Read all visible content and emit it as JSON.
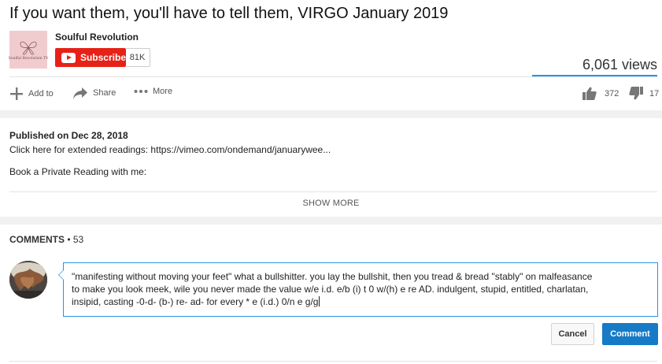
{
  "video": {
    "title": "If you want them, you'll have to tell them, VIRGO January 2019",
    "views": "6,061 views"
  },
  "channel": {
    "name": "Soulful Revolution",
    "thumb_text": "Soulful Revolution TV",
    "subscribe_label": "Subscribe",
    "subscriber_count": "81K"
  },
  "actions": {
    "add_to": "Add to",
    "share": "Share",
    "more": "More",
    "likes": "372",
    "dislikes": "17"
  },
  "description": {
    "published": "Published on Dec 28, 2018",
    "line1": "Click here for extended readings: https://vimeo.com/ondemand/januarywee...",
    "line2": "Book a Private Reading with me:",
    "show_more": "SHOW MORE"
  },
  "comments": {
    "header_label": "COMMENTS",
    "header_sep": " • ",
    "count": "53",
    "draft_lines": [
      "\"manifesting without moving your feet\"  what a bullshitter.  you lay the bullshit, then you tread & bread \"stably\" on malfeasance",
      "to make you look meek, wile you never made the value w/e i.d. e/b (i) t 0 w/(h) e re AD.  indulgent, stupid, entitled, charlatan,",
      "insipid,  casting -0-d- (b-) re- ad-  for every * e (i.d.) 0/n e g/g"
    ],
    "cancel_label": "Cancel",
    "submit_label": "Comment"
  },
  "colors": {
    "subscribe": "#e62117",
    "accent_blue": "#167ac6",
    "focus_blue": "#2793e6"
  }
}
